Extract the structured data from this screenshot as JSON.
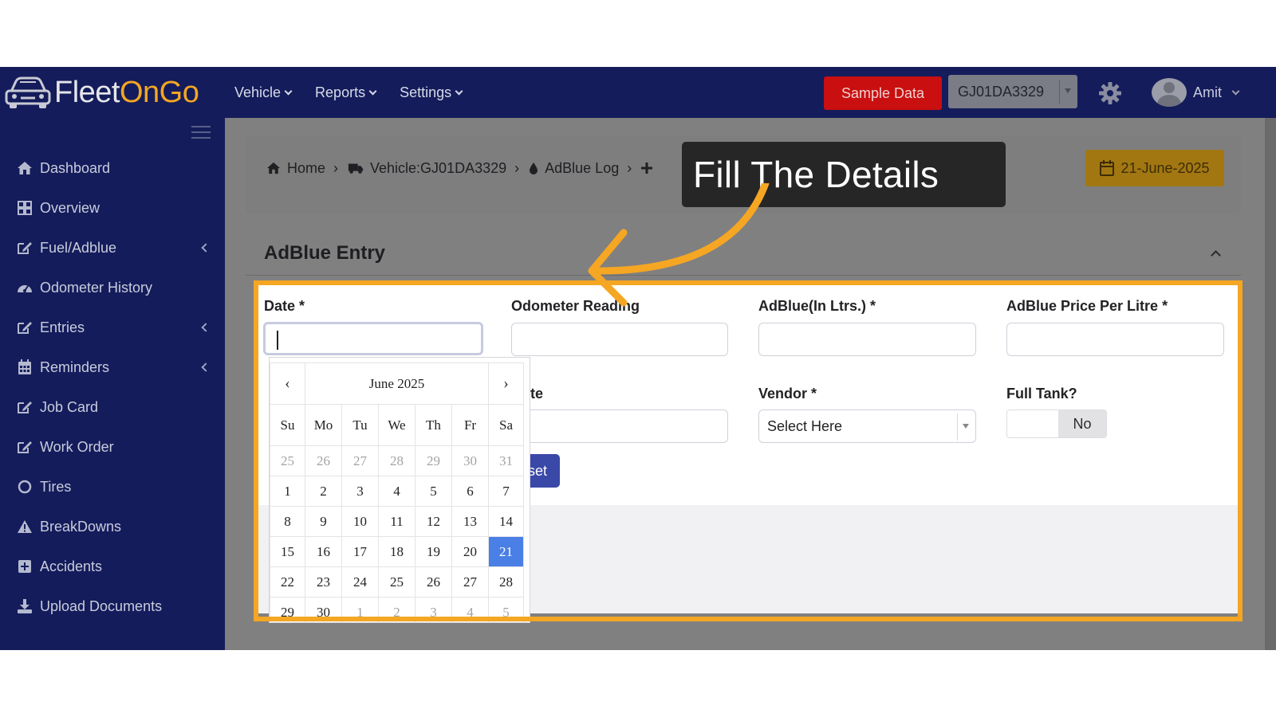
{
  "app": {
    "logo_prefix": "Fleet",
    "logo_accent": "OnGo",
    "brand_accent_color": "#f5a623"
  },
  "navbar": {
    "menu": [
      {
        "label": "Vehicle"
      },
      {
        "label": "Reports"
      },
      {
        "label": "Settings"
      }
    ],
    "sample_button": "Sample Data",
    "vehicle_select": "GJ01DA3329",
    "user_name": "Amit"
  },
  "sidebar": {
    "items": [
      {
        "label": "Dashboard",
        "icon": "home-icon"
      },
      {
        "label": "Overview",
        "icon": "grid-icon"
      },
      {
        "label": "Fuel/Adblue",
        "icon": "edit-icon",
        "has_submenu": true
      },
      {
        "label": "Odometer History",
        "icon": "gauge-icon"
      },
      {
        "label": "Entries",
        "icon": "edit-icon",
        "has_submenu": true
      },
      {
        "label": "Reminders",
        "icon": "calendar-icon",
        "has_submenu": true
      },
      {
        "label": "Job Card",
        "icon": "edit-icon"
      },
      {
        "label": "Work Order",
        "icon": "edit-icon"
      },
      {
        "label": "Tires",
        "icon": "circle-icon"
      },
      {
        "label": "BreakDowns",
        "icon": "warning-icon"
      },
      {
        "label": "Accidents",
        "icon": "plus-square-icon"
      },
      {
        "label": "Upload Documents",
        "icon": "download-icon"
      }
    ]
  },
  "breadcrumb": {
    "home": "Home",
    "vehicle": "Vehicle:GJ01DA3329",
    "log": "AdBlue Log"
  },
  "date_badge": "21-June-2025",
  "form": {
    "title": "AdBlue Entry",
    "date_label": "Date *",
    "odometer_label": "Odometer Reading",
    "adblue_label": "AdBlue(In Ltrs.) *",
    "price_label": "AdBlue Price Per Litre *",
    "rate_label_partial": "te",
    "vendor_label": "Vendor *",
    "vendor_placeholder": "Select Here",
    "full_tank_label": "Full Tank?",
    "full_tank_value": "No",
    "reset_partial": "set"
  },
  "datepicker": {
    "month_label": "June 2025",
    "prev": "‹",
    "next": "›",
    "weekdays": [
      "Su",
      "Mo",
      "Tu",
      "We",
      "Th",
      "Fr",
      "Sa"
    ],
    "weeks": [
      [
        "25",
        "26",
        "27",
        "28",
        "29",
        "30",
        "31"
      ],
      [
        "1",
        "2",
        "3",
        "4",
        "5",
        "6",
        "7"
      ],
      [
        "8",
        "9",
        "10",
        "11",
        "12",
        "13",
        "14"
      ],
      [
        "15",
        "16",
        "17",
        "18",
        "19",
        "20",
        "21"
      ],
      [
        "22",
        "23",
        "24",
        "25",
        "26",
        "27",
        "28"
      ],
      [
        "29",
        "30",
        "1",
        "2",
        "3",
        "4",
        "5"
      ]
    ],
    "selected_day": "21"
  },
  "callout": {
    "text": "Fill The Details"
  }
}
